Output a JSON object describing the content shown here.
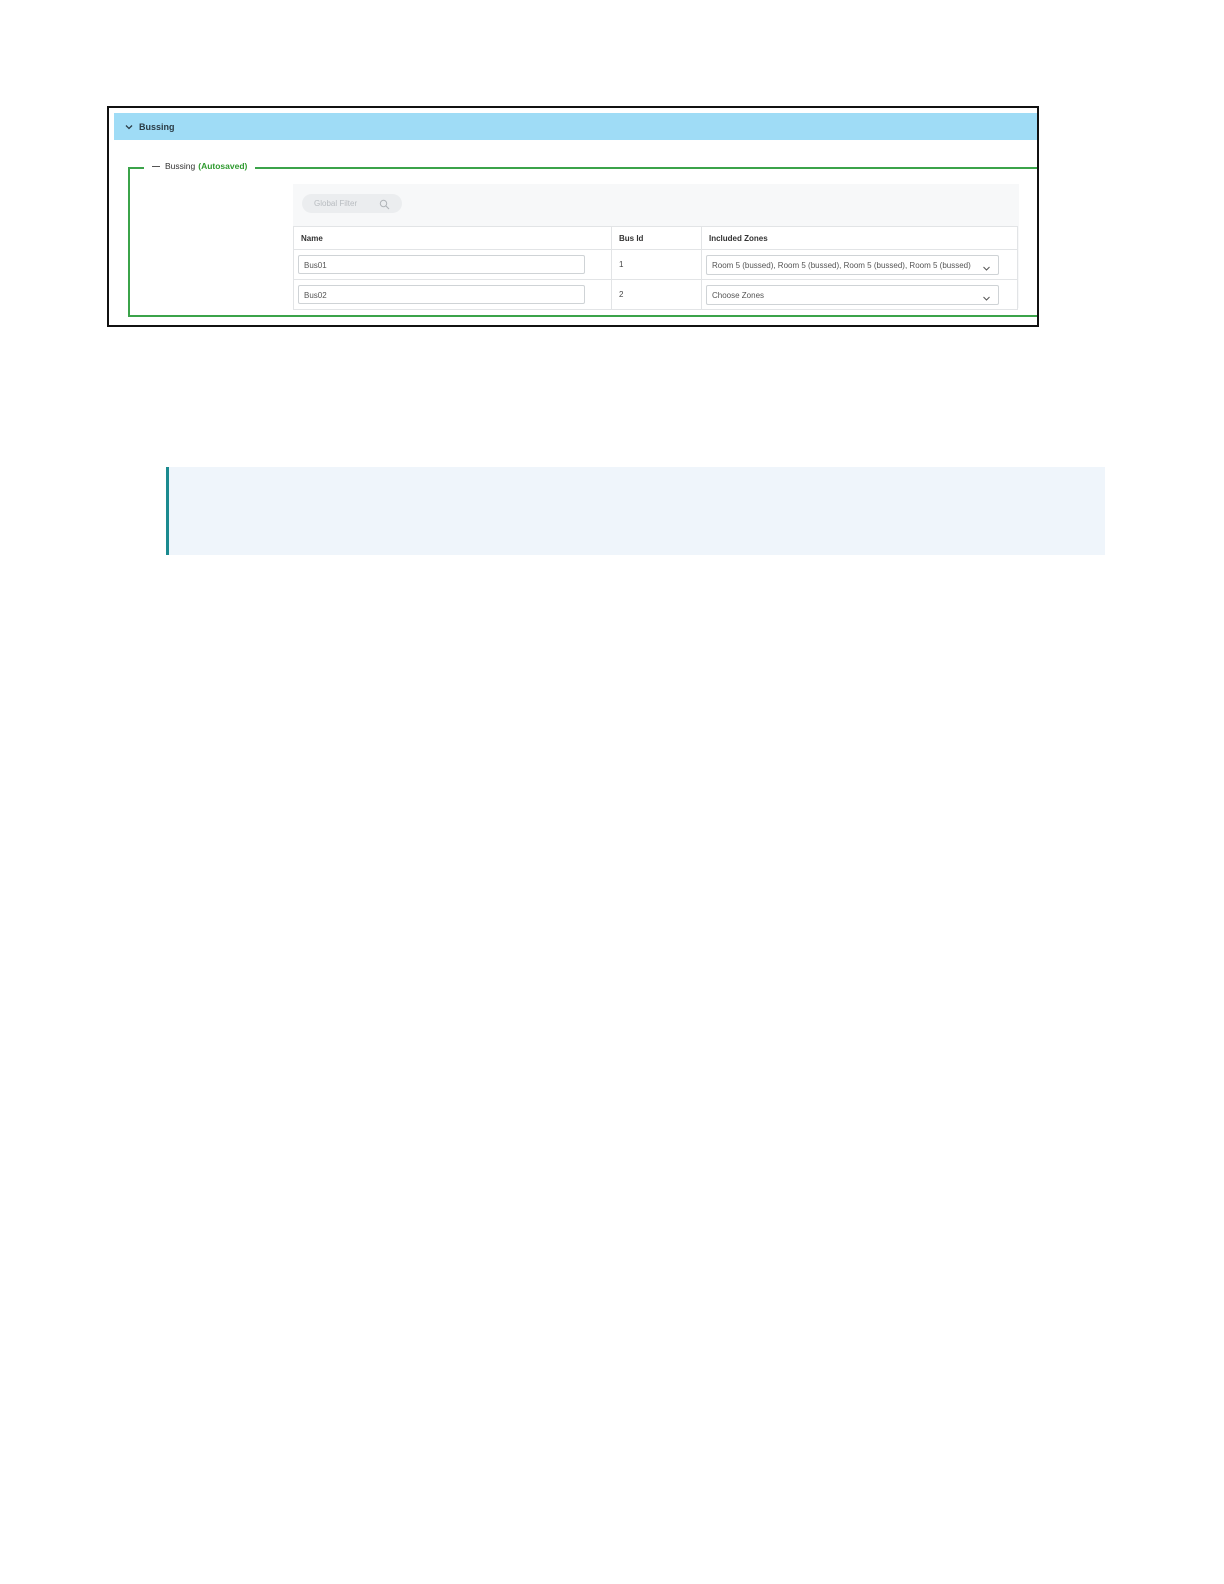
{
  "section": {
    "title": "Bussing",
    "group_title": "Bussing",
    "group_status": "(Autosaved)"
  },
  "filter": {
    "placeholder": "Global Filter"
  },
  "table": {
    "headers": [
      "Name",
      "Bus Id",
      "Included Zones"
    ],
    "rows": [
      {
        "name": "Bus01",
        "bus_id": "1",
        "zones": "Room 5 (bussed), Room 5 (bussed), Room 5 (bussed), Room 5 (bussed)"
      },
      {
        "name": "Bus02",
        "bus_id": "2",
        "zones": "Choose Zones"
      }
    ]
  },
  "colors": {
    "header_bg": "#9fdcf6",
    "group_border": "#3ba34a",
    "autosaved": "#2f9a2f",
    "note_border": "#1a8a8f",
    "note_bg": "#eff5fb"
  }
}
